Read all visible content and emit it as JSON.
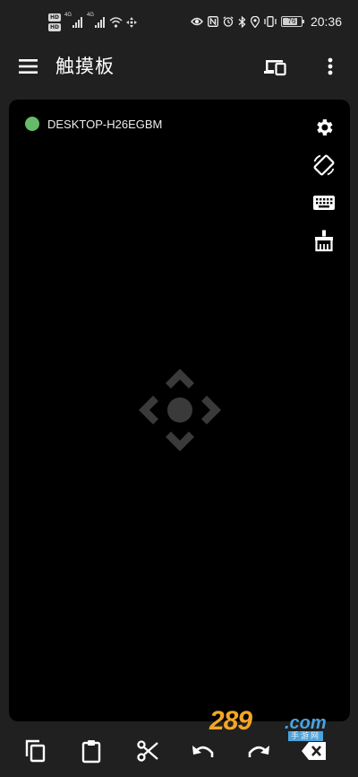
{
  "status_bar": {
    "hd_badges": [
      "HD",
      "HD"
    ],
    "net_labels": [
      "4G",
      "4G"
    ],
    "battery_level": "76",
    "time": "20:36",
    "icons": [
      "eye-icon",
      "nfc-icon",
      "alarm-icon",
      "bluetooth-icon",
      "location-icon",
      "vibrate-icon"
    ]
  },
  "app_bar": {
    "title": "触摸板",
    "icons": [
      "menu-icon",
      "devices-icon",
      "more-vert-icon"
    ]
  },
  "touchpad": {
    "device_name": "DESKTOP-H26EGBM",
    "status_color": "#66bb6a",
    "connected": true,
    "tools": [
      "settings-icon",
      "screen-rotation-icon",
      "keyboard-icon",
      "clear-icon"
    ]
  },
  "bottom_bar": {
    "actions": [
      "copy-icon",
      "paste-icon",
      "cut-icon",
      "undo-icon",
      "redo-icon",
      "backspace-icon"
    ]
  },
  "watermark": {
    "main": "289",
    "suffix": ".com",
    "sub": "手游网"
  },
  "colors": {
    "background": "#202020",
    "touchpad": "#000000",
    "connected": "#66bb6a",
    "watermark_orange": "#f5a623",
    "watermark_blue": "#4aa3df"
  }
}
